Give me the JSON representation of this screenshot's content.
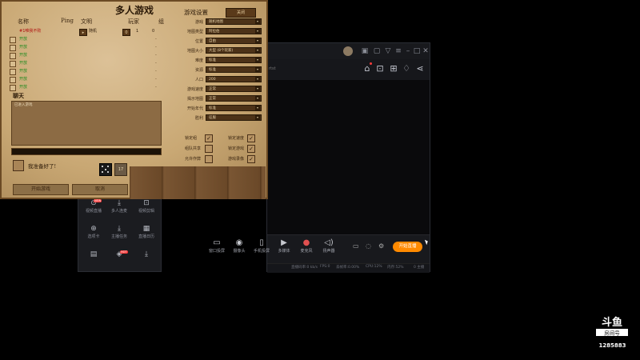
{
  "game": {
    "title": "多人游戏",
    "columns": {
      "name": "名称",
      "ping": "Ping",
      "civ": "文明",
      "player": "玩家",
      "team": "组"
    },
    "host": {
      "name": "#1唯我不败",
      "civ": "随机",
      "team": "0",
      "color": "1"
    },
    "players": [
      {
        "name": "开放"
      },
      {
        "name": "开放"
      },
      {
        "name": "开放"
      },
      {
        "name": "开放"
      },
      {
        "name": "开放"
      },
      {
        "name": "开放"
      },
      {
        "name": "开放"
      }
    ],
    "dash": "-",
    "chat_label": "聊天",
    "chat_lines": [
      "已进入游戏"
    ],
    "ready_label": "我准备好了!",
    "dice_number": "17",
    "start_button": "开始游戏",
    "cancel_button": "取消"
  },
  "settings": {
    "title": "游戏设置",
    "close_button": "关闭",
    "rows": [
      {
        "label": "游戏",
        "value": "随机地图"
      },
      {
        "label": "地图类型",
        "value": "阿拉伯"
      },
      {
        "label": "位置",
        "value": "自由"
      },
      {
        "label": "地图大小",
        "value": "大型 (8个玩家)"
      },
      {
        "label": "难度",
        "value": "标准"
      },
      {
        "label": "资源",
        "value": "标准"
      },
      {
        "label": "人口",
        "value": "200"
      },
      {
        "label": "游戏速度",
        "value": "正常"
      },
      {
        "label": "揭示地图",
        "value": "正常"
      },
      {
        "label": "开始年代",
        "value": "标准"
      },
      {
        "label": "胜利",
        "value": "征服"
      }
    ],
    "options": [
      {
        "label": "锁定组",
        "checked": true
      },
      {
        "label": "锁定速度",
        "checked": true
      },
      {
        "label": "组队共享",
        "checked": false
      },
      {
        "label": "锁定游戏",
        "checked": true
      },
      {
        "label": "允许作弊",
        "checked": false
      },
      {
        "label": "游戏录像",
        "checked": true
      }
    ]
  },
  "stream": {
    "url_fragment": "rtst",
    "bottom_tools": [
      {
        "icon": "screen-icon",
        "label": "窗口投屏"
      },
      {
        "icon": "camera-icon",
        "label": "摄像头"
      },
      {
        "icon": "phone-icon",
        "label": "手机投屏"
      },
      {
        "icon": "media-icon",
        "label": "多媒体"
      },
      {
        "icon": "mic-icon",
        "label": "麦克风"
      },
      {
        "icon": "speaker-icon",
        "label": "扬声器"
      }
    ],
    "start_live": "开始直播",
    "status": [
      "直播码率:0 kb/s",
      "FPS:0",
      "丢帧率:0.00%",
      "CPU:12%",
      "内存:52%",
      "0 主播"
    ],
    "left_panel": [
      {
        "icon": "video-icon",
        "label": "视频直播"
      },
      {
        "icon": "download-icon",
        "label": "多人连麦"
      },
      {
        "icon": "record-icon",
        "label": "视频剪辑"
      },
      {
        "icon": "gift-icon",
        "label": "选项卡"
      },
      {
        "icon": "download-icon",
        "label": "主播任务"
      },
      {
        "icon": "calendar-icon",
        "label": "直播日历"
      },
      {
        "icon": "image-icon",
        "label": ""
      },
      {
        "icon": "star-icon",
        "label": ""
      },
      {
        "icon": "download-icon",
        "label": ""
      }
    ],
    "left_panel_badges": [
      "NEW",
      "HOT"
    ]
  },
  "watermark": {
    "brand": "斗鱼",
    "sub": "房间号",
    "room_number": "1285883"
  }
}
